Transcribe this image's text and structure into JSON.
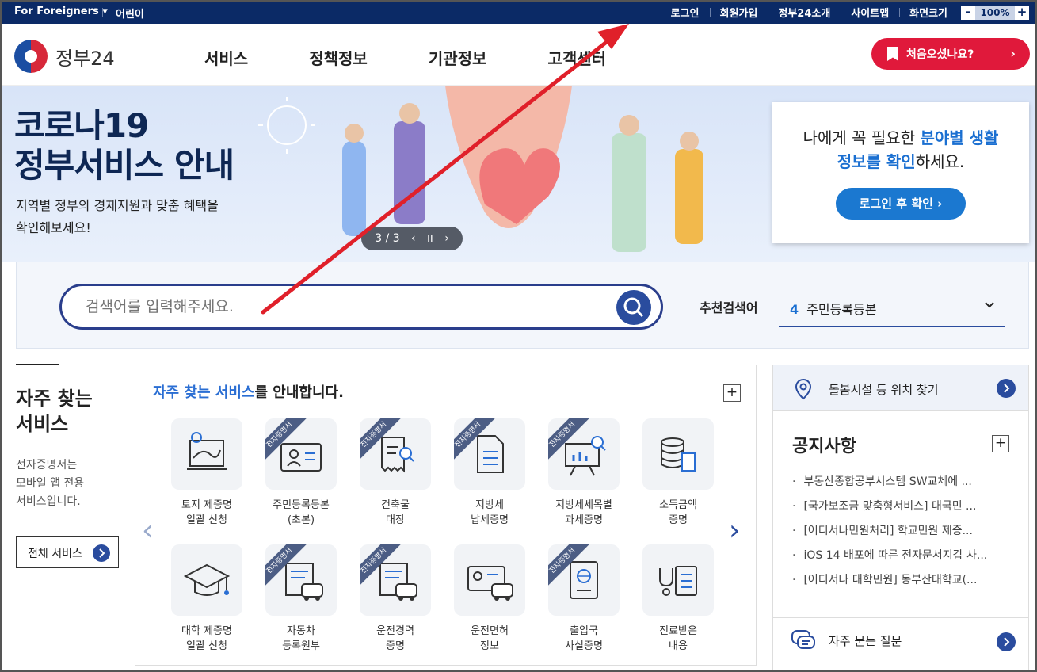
{
  "topbar": {
    "lang": "For Foreigners ▾",
    "kids": "어린이",
    "links": [
      "로그인",
      "회원가입",
      "정부24소개",
      "사이트맵",
      "화면크기"
    ],
    "zoom_minus": "-",
    "zoom_value": "100%",
    "zoom_plus": "+"
  },
  "header": {
    "logo_text": "정부24",
    "nav": [
      "서비스",
      "정책정보",
      "기관정보",
      "고객센터"
    ],
    "first_visit_label": "처음오셨나요?"
  },
  "banner": {
    "title_line1": "코로나19",
    "title_line2": "정부서비스 안내",
    "subtitle_line1": "지역별 정부의 경제지원과 맞춤 혜택을",
    "subtitle_line2": "확인해보세요!",
    "pager": "3 / 3"
  },
  "infobox": {
    "text_a": "나에게 꼭 필요한 ",
    "text_hl1": "분야별 생활",
    "text_hl2": "정보를 확인",
    "text_b": "하세요.",
    "button": "로그인 후 확인 ›"
  },
  "search": {
    "placeholder": "검색어를 입력해주세요.",
    "recommend_label": "추천검색어",
    "recommend_num": "4",
    "recommend_value": "주민등록등본"
  },
  "frequent": {
    "title_line1": "자주 찾는",
    "title_line2": "서비스",
    "desc_line1": "전자증명서는",
    "desc_line2": "모바일 앱 전용",
    "desc_line3": "서비스입니다.",
    "all_button": "전체 서비스"
  },
  "services": {
    "heading_hl": "자주 찾는 서비스",
    "heading_rest": "를 안내합니다.",
    "badge": "전자증명서",
    "items": [
      {
        "label": "토지 제증명\n일괄 신청",
        "badge": false,
        "icon": "map-document-icon"
      },
      {
        "label": "주민등록등본\n(초본)",
        "badge": true,
        "icon": "id-card-icon"
      },
      {
        "label": "건축물\n대장",
        "badge": true,
        "icon": "receipt-search-icon"
      },
      {
        "label": "지방세\n납세증명",
        "badge": true,
        "icon": "document-icon"
      },
      {
        "label": "지방세세목별\n과세증명",
        "badge": true,
        "icon": "chart-board-icon"
      },
      {
        "label": "소득금액\n증명",
        "badge": false,
        "icon": "coins-document-icon"
      },
      {
        "label": "대학 제증명\n일괄 신청",
        "badge": false,
        "icon": "graduation-cap-icon"
      },
      {
        "label": "자동차\n등록원부",
        "badge": true,
        "icon": "car-document-icon"
      },
      {
        "label": "운전경력\n증명",
        "badge": true,
        "icon": "car-document-icon"
      },
      {
        "label": "운전면허\n정보",
        "badge": false,
        "icon": "license-car-icon"
      },
      {
        "label": "출입국\n사실증명",
        "badge": true,
        "icon": "passport-icon"
      },
      {
        "label": "진료받은\n내용",
        "badge": false,
        "icon": "stethoscope-icon"
      }
    ]
  },
  "right": {
    "care_label": "돌봄시설 등 위치 찾기",
    "notice_title": "공지사항",
    "notices": [
      "부동산종합공부시스템 SW교체에 ...",
      "[국가보조금 맞춤형서비스] 대국민 ...",
      "[어디서나민원처리] 학교민원 제증...",
      "iOS 14 배포에 따른 전자문서지갑 사...",
      "[어디서나 대학민원] 동부산대학교(..."
    ],
    "faq_label": "자주 묻는 질문"
  },
  "colors": {
    "topbar": "#0b2a66",
    "accent_red": "#e0193b",
    "accent_blue": "#2a4c9e",
    "annotation_arrow": "#e0202a"
  }
}
